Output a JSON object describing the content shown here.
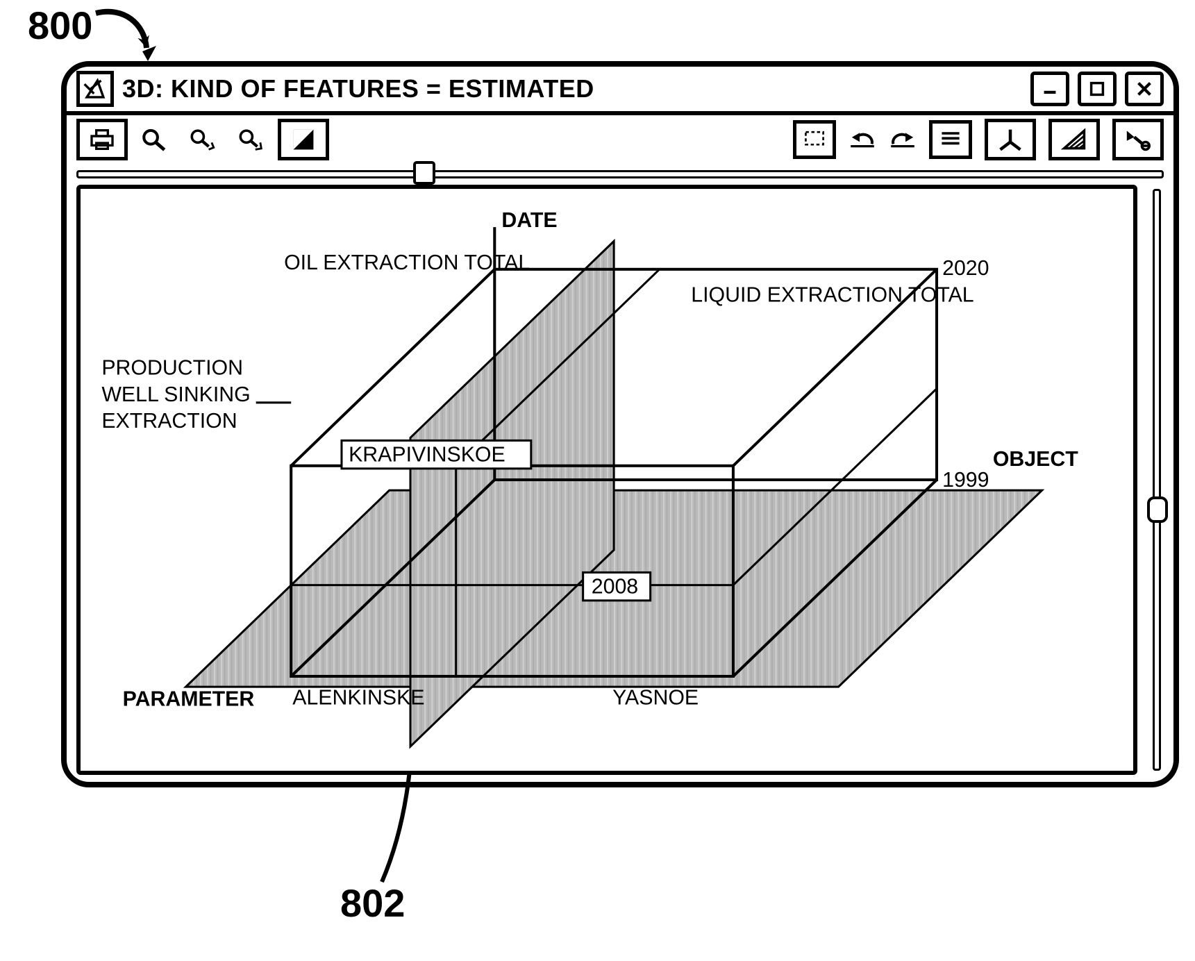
{
  "callouts": {
    "figure": "800",
    "plane": "802"
  },
  "window": {
    "title": "3D: KIND OF FEATURES = ESTIMATED"
  },
  "toolbar": {
    "print": "print-icon",
    "zoom": "zoom-icon",
    "zoom_in": "zoom-in-icon",
    "zoom_out": "zoom-out-icon",
    "contrast": "contrast-icon",
    "select": "select-box-icon",
    "undo": "undo-icon",
    "redo": "redo-icon",
    "lines": "lines-icon",
    "axes": "axes-icon",
    "hatch": "hatch-icon",
    "reset": "reset-icon"
  },
  "chart_data": {
    "type": "cube-slice",
    "axes": {
      "vertical": "DATE",
      "front_left": "PARAMETER",
      "front_right": "OBJECT"
    },
    "date_top": "2020",
    "date_bottom": "1999",
    "date_slice": "2008",
    "parameter_back_left": "OIL EXTRACTION TOTAL",
    "parameter_back_right": "LIQUID EXTRACTION TOTAL",
    "parameter_side_multiline": "PRODUCTION\nWELL SINKING\nEXTRACTION",
    "parameter_side_1": "PRODUCTION",
    "parameter_side_2": "WELL SINKING",
    "parameter_side_3": "EXTRACTION",
    "object_left": "ALENKINSKE",
    "object_right": "YASNOE",
    "object_slice": "KRAPIVINSKOE"
  }
}
